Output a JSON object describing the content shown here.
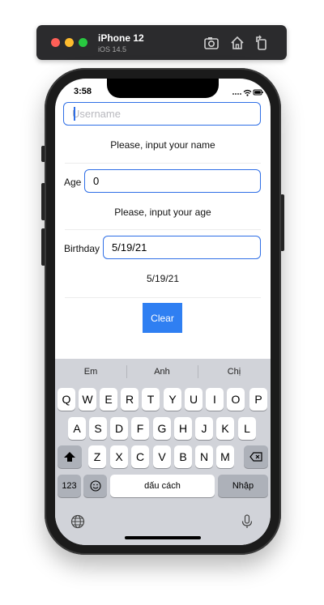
{
  "simulator": {
    "device": "iPhone 12",
    "os": "iOS 14.5"
  },
  "status_bar": {
    "time": "3:58"
  },
  "form": {
    "username": {
      "value": "",
      "placeholder": "Username",
      "hint": "Please, input your name"
    },
    "age": {
      "label": "Age",
      "value": "0",
      "hint": "Please, input your age"
    },
    "birthday": {
      "label": "Birthday",
      "value": "5/19/21",
      "display": "5/19/21"
    },
    "clear_label": "Clear"
  },
  "keyboard": {
    "suggestions": [
      "Em",
      "Anh",
      "Chị"
    ],
    "row1": [
      "Q",
      "W",
      "E",
      "R",
      "T",
      "Y",
      "U",
      "I",
      "O",
      "P"
    ],
    "row2": [
      "A",
      "S",
      "D",
      "F",
      "G",
      "H",
      "J",
      "K",
      "L"
    ],
    "row3": [
      "Z",
      "X",
      "C",
      "V",
      "B",
      "N",
      "M"
    ],
    "numbers_label": "123",
    "space_label": "dấu cách",
    "return_label": "Nhập"
  },
  "colors": {
    "accent": "#2f7ff2",
    "field_border": "#2f6fe6",
    "keyboard_bg": "#d1d3d9"
  }
}
